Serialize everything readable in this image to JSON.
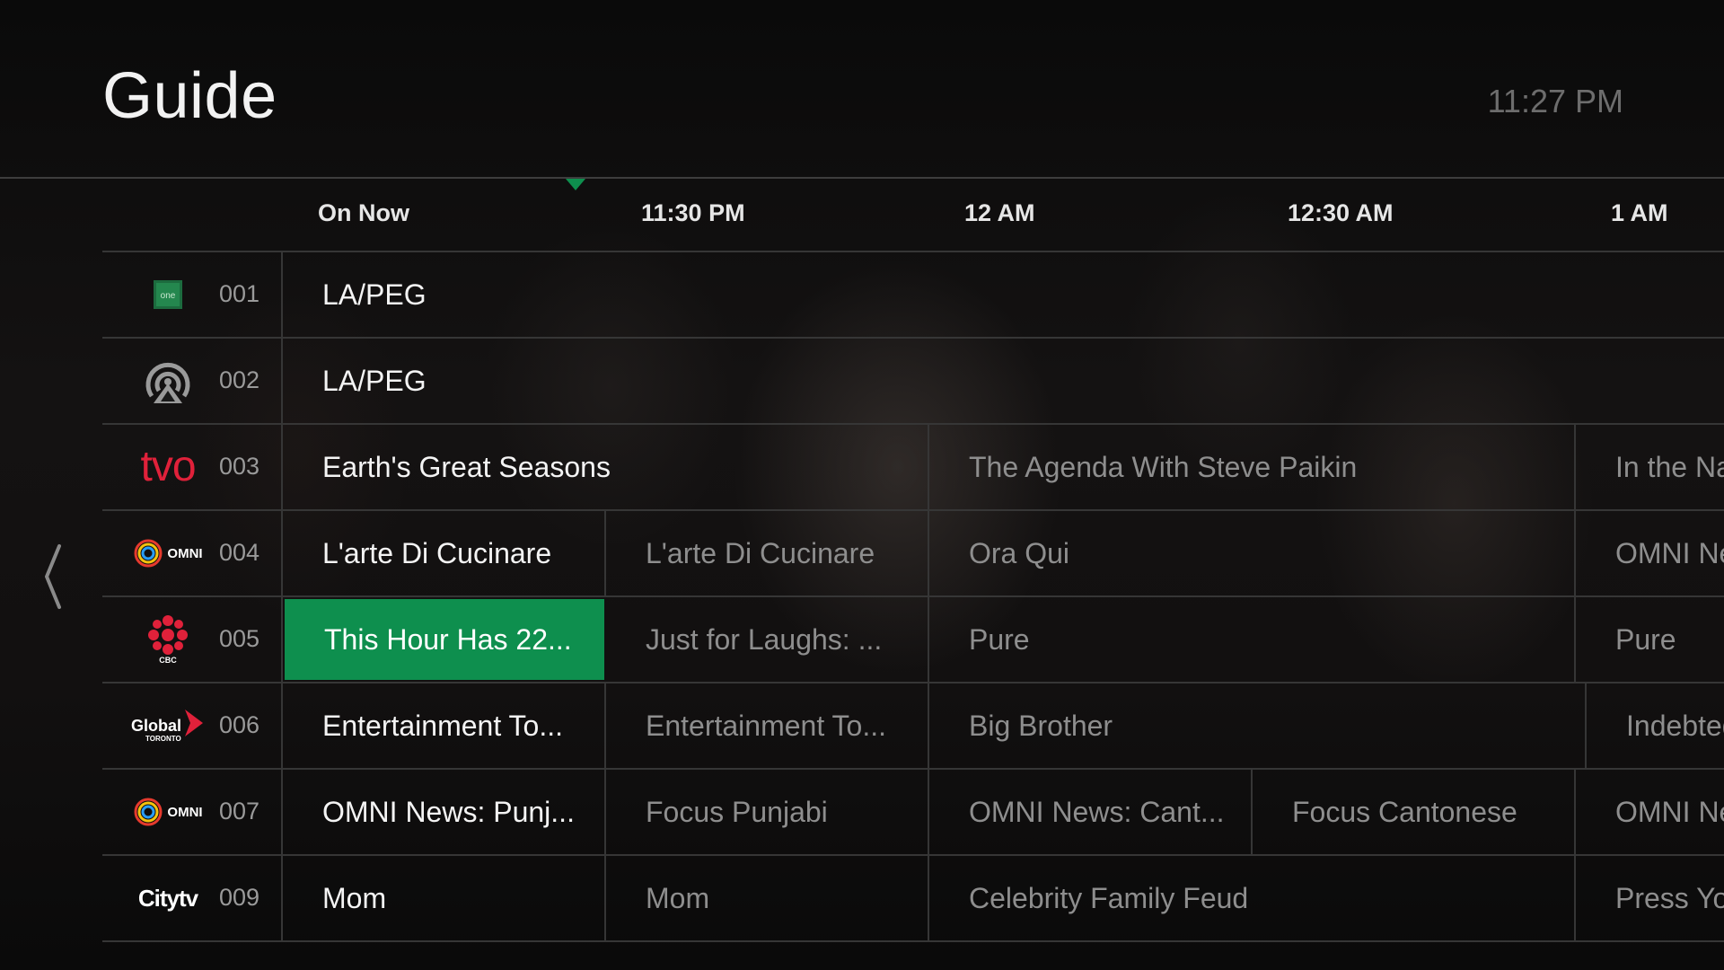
{
  "header": {
    "title": "Guide",
    "clock": "11:27 PM"
  },
  "timeline": {
    "slots": [
      "On Now",
      "11:30 PM",
      "12 AM",
      "12:30 AM",
      "1 AM"
    ]
  },
  "colors": {
    "accent": "#0e8f4e",
    "background": "#0b0b0b",
    "divider": "#363636"
  },
  "channels": [
    {
      "number": "001",
      "logo": "one-logo-icon",
      "logo_text": "one",
      "programs": [
        {
          "title": "LA/PEG",
          "span": "on-now-to-end"
        }
      ]
    },
    {
      "number": "002",
      "logo": "broadcast-signal-icon",
      "programs": [
        {
          "title": "LA/PEG",
          "span": "on-now-to-end"
        }
      ]
    },
    {
      "number": "003",
      "logo": "tvo-logo-icon",
      "logo_text": "tvo",
      "programs": [
        {
          "title": "Earth's Great Seasons"
        },
        {
          "title": "The Agenda With Steve Paikin"
        },
        {
          "title": "In the Na"
        }
      ]
    },
    {
      "number": "004",
      "logo": "omni-logo-icon",
      "logo_text": "OMNI",
      "programs": [
        {
          "title": "L'arte Di Cucinare"
        },
        {
          "title": "L'arte Di Cucinare"
        },
        {
          "title": "Ora Qui"
        },
        {
          "title": "OMNI Ne"
        }
      ]
    },
    {
      "number": "005",
      "logo": "cbc-logo-icon",
      "logo_text": "CBC",
      "programs": [
        {
          "title": "This Hour Has 22...",
          "focused": true
        },
        {
          "title": "Just for Laughs: ..."
        },
        {
          "title": "Pure"
        },
        {
          "title": "Pure"
        }
      ]
    },
    {
      "number": "006",
      "logo": "global-toronto-logo-icon",
      "logo_text": "Global",
      "logo_subtext": "TORONTO",
      "programs": [
        {
          "title": "Entertainment To..."
        },
        {
          "title": "Entertainment To..."
        },
        {
          "title": "Big Brother"
        },
        {
          "title": "Indebted"
        }
      ]
    },
    {
      "number": "007",
      "logo": "omni-logo-icon",
      "logo_text": "OMNI",
      "programs": [
        {
          "title": "OMNI News: Punj..."
        },
        {
          "title": "Focus Punjabi"
        },
        {
          "title": "OMNI News: Cant..."
        },
        {
          "title": "Focus Cantonese"
        },
        {
          "title": "OMNI Ne"
        }
      ]
    },
    {
      "number": "009",
      "logo": "citytv-logo-icon",
      "logo_text": "Citytv",
      "programs": [
        {
          "title": "Mom"
        },
        {
          "title": "Mom"
        },
        {
          "title": "Celebrity Family Feud"
        },
        {
          "title": "Press Yo"
        }
      ]
    }
  ]
}
